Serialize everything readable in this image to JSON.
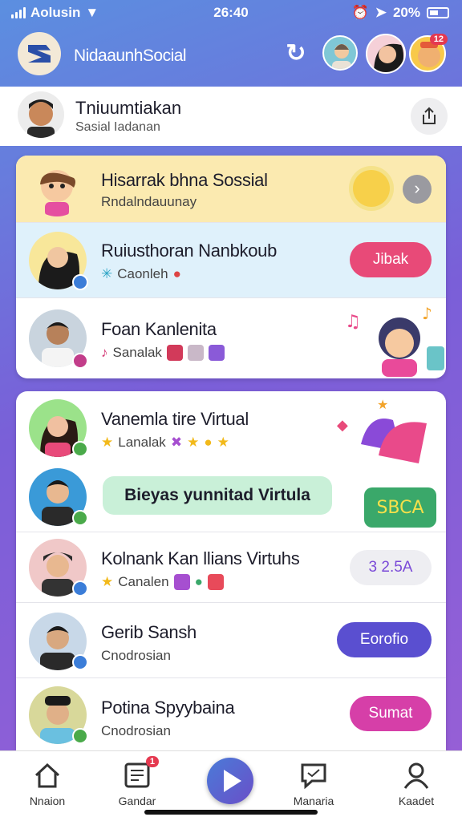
{
  "status": {
    "carrier": "Aolusin",
    "time": "26:40",
    "battery": "20%"
  },
  "app": {
    "title": "NidaaunhSocial",
    "notif_count": "12"
  },
  "profile": {
    "name": "Tniuumtiakan",
    "subtitle": "Sasial Iadanan"
  },
  "featured": {
    "title": "Hisarrak bhna Sossial",
    "subtitle": "Rndalndauunay"
  },
  "card1": [
    {
      "title": "Ruiusthoran Nanbkoub",
      "subtitle": "Caonleh",
      "action": "Jibak"
    },
    {
      "title": "Foan Kanlenita",
      "subtitle": "Sanalak"
    }
  ],
  "card2": [
    {
      "title": "Vanemla tire Virtual",
      "subtitle": "Lanalak"
    },
    {
      "title": "",
      "bubble": "Bieyas yunnitad Virtula"
    },
    {
      "title": "Kolnank Kan llians Virtuhs",
      "subtitle": "Canalen",
      "action": "3 2.5A"
    },
    {
      "title": "Gerib Sansh",
      "subtitle": "Cnodrosian",
      "action": "Eorofio"
    },
    {
      "title": "Potina Spyybaina",
      "subtitle": "Cnodrosian",
      "action": "Sumat"
    }
  ],
  "sticker_text": "SBCA",
  "nav": {
    "home": "Nnaion",
    "feed": "Gandar",
    "feed_badge": "1",
    "chat": "Manaria",
    "profile": "Kaadet"
  },
  "colors": {
    "accent": "#6a4fc8",
    "pink": "#e0407a",
    "purple": "#5a4fd0",
    "magenta": "#d63fa8"
  }
}
